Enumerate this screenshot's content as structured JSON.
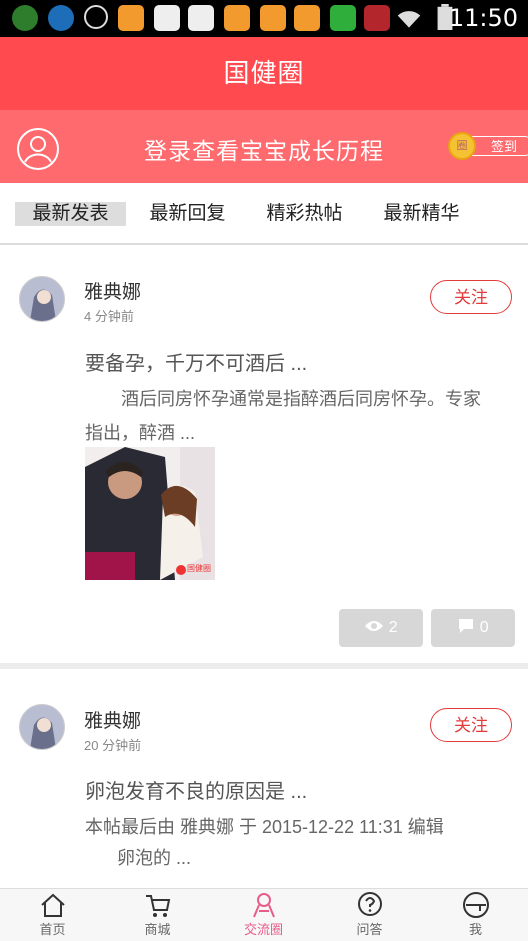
{
  "status_bar": {
    "time": "11:50",
    "icons": [
      "app-icon",
      "app-icon",
      "target-icon",
      "app-icon",
      "mail-icon",
      "mail-icon",
      "app-icon",
      "app-icon",
      "app-icon",
      "lock-app-icon",
      "news-app-icon",
      "wifi-icon",
      "battery-icon"
    ],
    "colors": {
      "background": "#000000"
    }
  },
  "header": {
    "title": "国健圈",
    "color": "#ff4a4f"
  },
  "login_banner": {
    "text": "登录查看宝宝成长历程",
    "sign_in_label": "签到",
    "coin_label": "圈",
    "color": "#ff6a6e"
  },
  "tabs": [
    {
      "label": "最新发表",
      "active": true
    },
    {
      "label": "最新回复",
      "active": false
    },
    {
      "label": "精彩热帖",
      "active": false
    },
    {
      "label": "最新精华",
      "active": false
    }
  ],
  "posts": [
    {
      "author": "雅典娜",
      "time": "4 分钟前",
      "follow_label": "关注",
      "title": "要备孕，千万不可酒后 ...",
      "body": "　　酒后同房怀孕通常是指醉酒后同房怀孕。专家指出，醉酒 ...",
      "views": "2",
      "comments": "0",
      "image_watermark": "国健圈"
    },
    {
      "author": "雅典娜",
      "time": "20 分钟前",
      "follow_label": "关注",
      "title": "卵泡发育不良的原因是 ...",
      "body": "本帖最后由 雅典娜 于 2015-12-22 11:31 编辑",
      "body2": "卵泡的 ..."
    }
  ],
  "bottom_nav": [
    {
      "label": "首页",
      "icon": "home-icon",
      "active": false
    },
    {
      "label": "商城",
      "icon": "cart-icon",
      "active": false
    },
    {
      "label": "交流圈",
      "icon": "community-icon",
      "active": true
    },
    {
      "label": "问答",
      "icon": "question-icon",
      "active": false
    },
    {
      "label": "我",
      "icon": "user-icon",
      "active": false
    }
  ],
  "accent_color": "#e85c8a"
}
